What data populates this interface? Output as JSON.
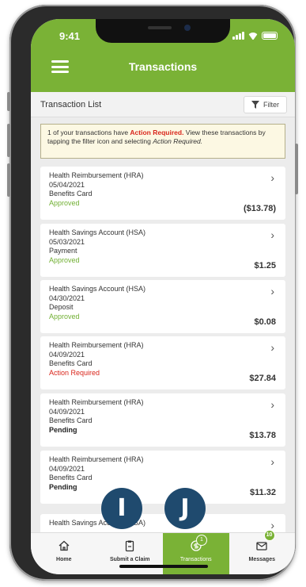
{
  "status_bar": {
    "time": "9:41"
  },
  "header": {
    "title": "Transactions"
  },
  "list": {
    "title": "Transaction List",
    "filter_label": "Filter"
  },
  "alert": {
    "part1": "1 of your transactions have ",
    "highlight": "Action Required.",
    "part2": " View these transactions by tapping the filter icon and selecting ",
    "italic": "Action Required."
  },
  "transactions": [
    {
      "account": "Health Reimbursement (HRA)",
      "date": "05/04/2021",
      "type": "Benefits Card",
      "status": "Approved",
      "amount": "($13.78)"
    },
    {
      "account": "Health Savings Account (HSA)",
      "date": "05/03/2021",
      "type": "Payment",
      "status": "Approved",
      "amount": "$1.25"
    },
    {
      "account": "Health Savings Account (HSA)",
      "date": "04/30/2021",
      "type": "Deposit",
      "status": "Approved",
      "amount": "$0.08"
    },
    {
      "account": "Health Reimbursement (HRA)",
      "date": "04/09/2021",
      "type": "Benefits Card",
      "status": "Action Required",
      "amount": "$27.84"
    },
    {
      "account": "Health Reimbursement (HRA)",
      "date": "04/09/2021",
      "type": "Benefits Card",
      "status": "Pending",
      "amount": "$13.78"
    },
    {
      "account": "Health Reimbursement (HRA)",
      "date": "04/09/2021",
      "type": "Benefits Card",
      "status": "Pending",
      "amount": "$11.32"
    },
    {
      "account": "Health Savings Account (HSA)",
      "date": "",
      "type": "",
      "status": "",
      "amount": ""
    }
  ],
  "tabs": [
    {
      "label": "Home",
      "icon": "home-icon"
    },
    {
      "label": "Submit a Claim",
      "icon": "clipboard-icon"
    },
    {
      "label": "Transactions",
      "icon": "transactions-icon",
      "badge": "1"
    },
    {
      "label": "Messages",
      "icon": "envelope-icon",
      "badge": "10"
    }
  ],
  "markers": {
    "i": "I",
    "j": "J"
  },
  "colors": {
    "brand_green": "#7ab236",
    "action_red": "#d9261c",
    "marker_navy": "#1f4a6e"
  }
}
